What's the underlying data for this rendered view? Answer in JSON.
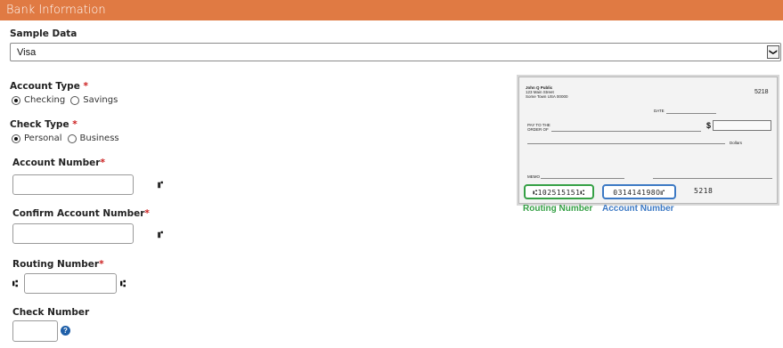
{
  "header": {
    "title": "Bank Information"
  },
  "sample_data": {
    "label": "Sample Data",
    "selected": "Visa",
    "arrow": "❯"
  },
  "account_type": {
    "label": "Account Type",
    "required": "*",
    "options": [
      "Checking",
      "Savings"
    ],
    "selected": "Checking"
  },
  "check_type": {
    "label": "Check Type",
    "required": "*",
    "options": [
      "Personal",
      "Business"
    ],
    "selected": "Personal"
  },
  "account_number": {
    "label": "Account Number",
    "required": "*",
    "suffix_symbol": "⑈"
  },
  "confirm_account_number": {
    "label": "Confirm Account Number",
    "required": "*",
    "suffix_symbol": "⑈"
  },
  "routing_number": {
    "label": "Routing Number",
    "required": "*",
    "prefix_symbol": "⑆",
    "suffix_symbol": "⑆"
  },
  "check_number": {
    "label": "Check Number",
    "help_icon": "question-circle-icon",
    "help_symbol": "?"
  },
  "check_image": {
    "name": "John Q Public",
    "address1": "123 Main Street",
    "address2": "Some Town USA 00000",
    "check_no": "5218",
    "date_label": "DATE",
    "pay_to_label_1": "PAY TO THE",
    "pay_to_label_2": "ORDER OF",
    "dollar_sign": "$",
    "dollars_label": "Dollars",
    "memo_label": "MEMO",
    "micr_routing": "⑆102515151⑆",
    "micr_account": "031414198O⑈",
    "micr_serial": "5218"
  },
  "captions": {
    "routing": "Routing Number",
    "account": "Account Number"
  },
  "colors": {
    "header": "#e07a43",
    "routing": "#35a045",
    "account": "#3c79c4",
    "required": "#cc1f1f"
  }
}
